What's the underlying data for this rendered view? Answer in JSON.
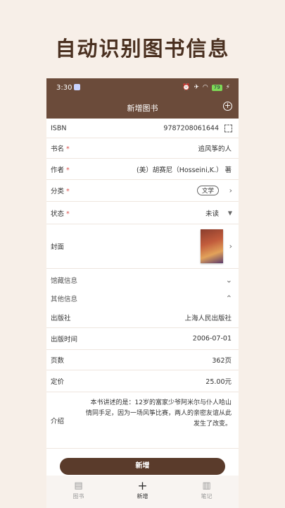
{
  "promo": {
    "title": "自动识别图书信息"
  },
  "status_bar": {
    "time": "3:30",
    "battery": "79"
  },
  "header": {
    "title": "新增图书"
  },
  "fields": {
    "isbn": {
      "label": "ISBN",
      "value": "9787208061644"
    },
    "title": {
      "label": "书名",
      "required": "*",
      "value": "追风筝的人"
    },
    "author": {
      "label": "作者",
      "required": "*",
      "value": "(美）胡赛尼（Hosseini,K.） 著"
    },
    "category": {
      "label": "分类",
      "required": "*",
      "value": "文学"
    },
    "status": {
      "label": "状态",
      "required": "*",
      "value": "未读"
    },
    "cover": {
      "label": "封面"
    }
  },
  "sections": {
    "collection": {
      "label": "馆藏信息"
    },
    "other": {
      "label": "其他信息"
    }
  },
  "other_info": {
    "publisher": {
      "label": "出版社",
      "value": "上海人民出版社"
    },
    "pub_date": {
      "label": "出版时间",
      "value": "2006-07-01"
    },
    "pages": {
      "label": "页数",
      "value": "362页"
    },
    "price": {
      "label": "定价",
      "value": "25.00元"
    },
    "intro": {
      "label": "介绍",
      "value": "本书讲述的是：12岁的富家少爷阿米尔与仆人哈山情同手足，因为一场风筝比赛，两人的亲密友谊从此发生了改变。"
    }
  },
  "submit_label": "新增",
  "tabs": [
    {
      "label": "图书",
      "icon": "book-icon"
    },
    {
      "label": "新增",
      "icon": "plus-icon"
    },
    {
      "label": "笔记",
      "icon": "note-icon"
    }
  ]
}
